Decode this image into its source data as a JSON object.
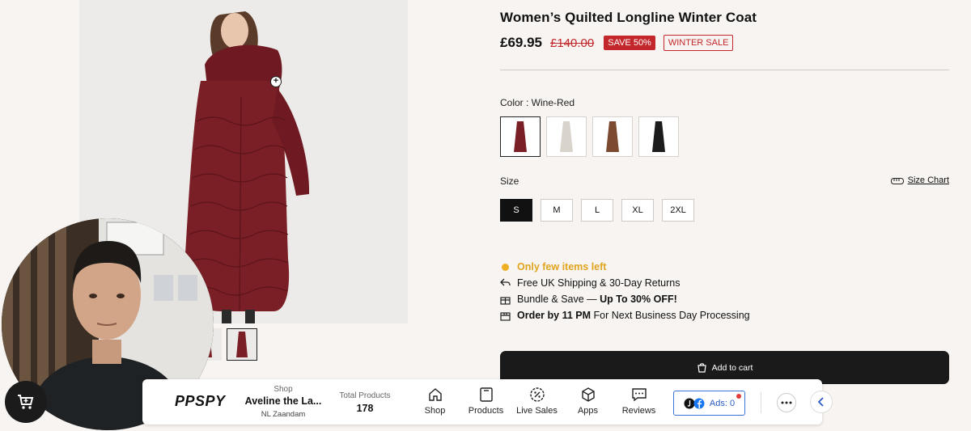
{
  "product": {
    "title": "Women’s Quilted Longline Winter Coat",
    "price": "£69.95",
    "old_price": "£140.00",
    "badge_save": "SAVE 50%",
    "badge_sale": "WINTER SALE"
  },
  "color": {
    "label": "Color : Wine-Red",
    "swatches": [
      {
        "name": "Wine-Red",
        "hex": "#7a1f26"
      },
      {
        "name": "Beige",
        "hex": "#d8d4cc"
      },
      {
        "name": "Brown",
        "hex": "#7b4a30"
      },
      {
        "name": "Black",
        "hex": "#1c1c1c"
      }
    ]
  },
  "size": {
    "label": "Size",
    "chart_label": "Size Chart",
    "options": [
      "S",
      "M",
      "L",
      "XL",
      "2XL"
    ],
    "selected": "S"
  },
  "info": {
    "stock": "Only few items left",
    "shipping": "Free UK Shipping & 30-Day Returns",
    "bundle_prefix": "Bundle & Save — ",
    "bundle_bold": "Up To 30% OFF!",
    "order_bold": "Order by 11 PM",
    "order_suffix": " For Next Business Day Processing"
  },
  "cart": {
    "add_label": "Add to cart"
  },
  "colors": {
    "accent": "#c3272b",
    "stock": "#e0a41f",
    "coat": "#7a1f26"
  },
  "spybar": {
    "logo": "PPSPY",
    "shop_caption": "Shop",
    "shop_name": "Aveline the La...",
    "shop_location": "NL Zaandam",
    "total_caption": "Total Products",
    "total_value": "178",
    "nav": [
      {
        "label": "Shop",
        "icon": "home-icon"
      },
      {
        "label": "Products",
        "icon": "box-icon"
      },
      {
        "label": "Live Sales",
        "icon": "percent-badge-icon"
      },
      {
        "label": "Apps",
        "icon": "cube-icon"
      },
      {
        "label": "Reviews",
        "icon": "chat-icon"
      }
    ],
    "ads_label": "Ads: 0"
  }
}
